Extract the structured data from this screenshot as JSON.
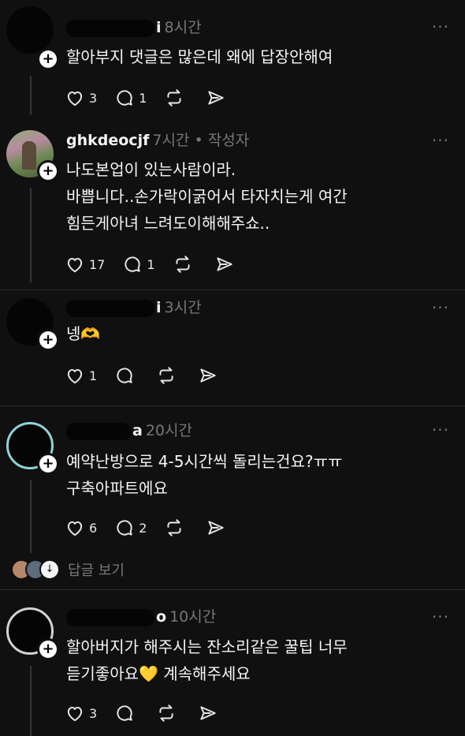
{
  "comments": [
    {
      "username": "i",
      "time": "8시간",
      "badge": "",
      "lines": [
        "할아부지 댓글은 많은데 왜에 답장안해여"
      ],
      "likes": "3",
      "replies": "1",
      "reposts": "",
      "shares": ""
    },
    {
      "username": "ghkdeocjf",
      "time": "7시간",
      "badge": "• 작성자",
      "lines": [
        "나도본업이 있는사람이라.",
        "바쁩니다..손가락이굵어서 타자치는게 여간",
        "힘든게아녀 느려도이해해주쇼.."
      ],
      "likes": "17",
      "replies": "1",
      "reposts": "",
      "shares": ""
    },
    {
      "username": "i",
      "time": "3시간",
      "badge": "",
      "lines": [
        "넹🫶"
      ],
      "likes": "1",
      "replies": "",
      "reposts": "",
      "shares": ""
    },
    {
      "username": "a",
      "time": "20시간",
      "badge": "",
      "lines": [
        "예약난방으로 4-5시간씩 돌리는건요?ㅠㅠ",
        "구축아파트에요"
      ],
      "likes": "6",
      "replies": "2",
      "reposts": "",
      "shares": ""
    },
    {
      "username": "o",
      "time": "10시간",
      "badge": "",
      "lines": [
        "할아버지가 해주시는 잔소리같은 꿀팁 너무",
        "듣기좋아요💛 계속해주세요"
      ],
      "likes": "3",
      "replies": "",
      "reposts": "",
      "shares": ""
    }
  ],
  "view_replies_label": "답글 보기",
  "more_icon": "···",
  "follow_glyph": "+",
  "colors": {
    "background": "#101010",
    "text": "#f3f5f7",
    "muted": "#777777",
    "divider": "#2a2a2a"
  }
}
